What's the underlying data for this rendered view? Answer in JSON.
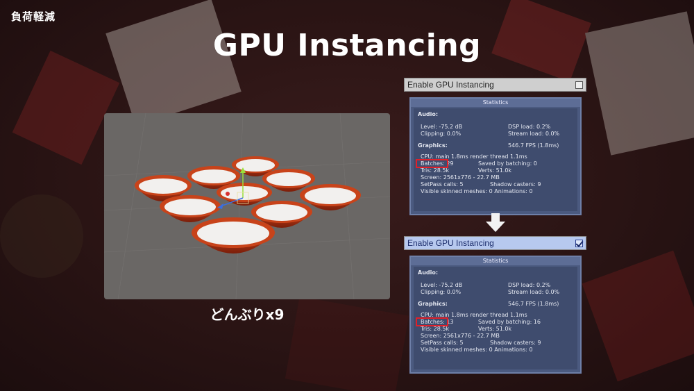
{
  "corner_label": "負荷軽減",
  "title": "GPU Instancing",
  "caption": "どんぶりx9",
  "panels": [
    {
      "toggle_label": "Enable GPU Instancing",
      "checked": false,
      "stats": {
        "header": "Statistics",
        "audio_heading": "Audio:",
        "level": "Level: -75.2 dB",
        "clipping": "Clipping: 0.0%",
        "dsp": "DSP load: 0.2%",
        "stream": "Stream load: 0.0%",
        "graphics_heading": "Graphics:",
        "fps": "546.7 FPS (1.8ms)",
        "cpu": "CPU: main 1.8ms  render thread 1.1ms",
        "batches": "Batches: 29",
        "saved": "Saved by batching: 0",
        "tris": "Tris: 28.5k",
        "verts": "Verts: 51.0k",
        "screen": "Screen: 2561x776 - 22.7 MB",
        "setpass": "SetPass calls: 5",
        "shadow": "Shadow casters: 9",
        "skinned": "Visible skinned meshes: 0  Animations: 0"
      }
    },
    {
      "toggle_label": "Enable GPU Instancing",
      "checked": true,
      "stats": {
        "header": "Statistics",
        "audio_heading": "Audio:",
        "level": "Level: -75.2 dB",
        "clipping": "Clipping: 0.0%",
        "dsp": "DSP load: 0.2%",
        "stream": "Stream load: 0.0%",
        "graphics_heading": "Graphics:",
        "fps": "546.7 FPS (1.8ms)",
        "cpu": "CPU: main 1.8ms  render thread 1.1ms",
        "batches": "Batches: 13",
        "saved": "Saved by batching: 16",
        "tris": "Tris: 28.5k",
        "verts": "Verts: 51.0k",
        "screen": "Screen: 2561x776 - 22.7 MB",
        "setpass": "SetPass calls: 5",
        "shadow": "Shadow casters: 9",
        "skinned": "Visible skinned meshes: 0  Animations: 0"
      }
    }
  ],
  "icons": {
    "arrow": "down-arrow-icon"
  },
  "colors": {
    "highlight": "#e0202a",
    "stats_bg": "#4b5a80"
  }
}
